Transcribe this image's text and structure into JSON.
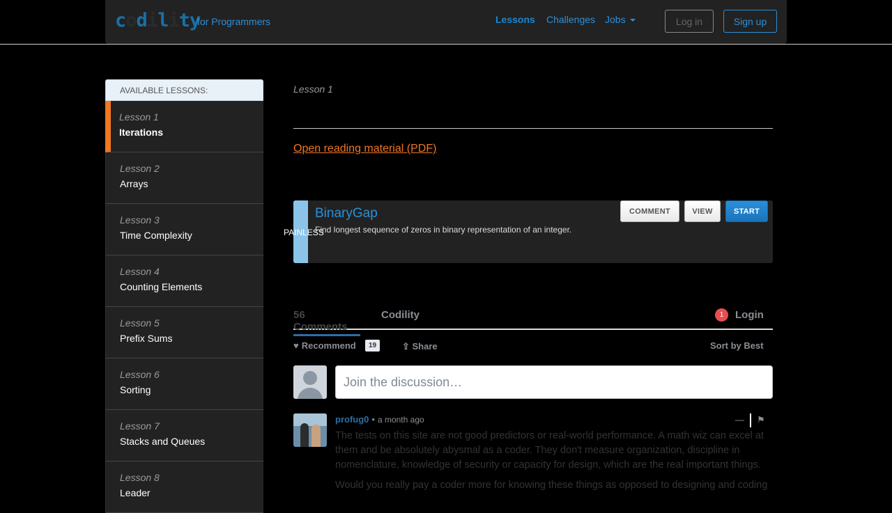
{
  "header": {
    "logo_text": [
      "c",
      "o",
      "d",
      "i",
      "l",
      "i",
      "t",
      "y"
    ],
    "tagline": "for Programmers",
    "nav": [
      {
        "label": "Lessons",
        "active": true
      },
      {
        "label": "Challenges",
        "active": false
      },
      {
        "label": "Jobs",
        "active": false
      }
    ],
    "login_label": "Log in",
    "signup_label": "Sign up"
  },
  "sidebar": {
    "heading": "AVAILABLE LESSONS:",
    "items": [
      {
        "num": "Lesson 1",
        "name": "Iterations"
      },
      {
        "num": "Lesson 2",
        "name": "Arrays"
      },
      {
        "num": "Lesson 3",
        "name": "Time Complexity"
      },
      {
        "num": "Lesson 4",
        "name": "Counting Elements"
      },
      {
        "num": "Lesson 5",
        "name": "Prefix Sums"
      },
      {
        "num": "Lesson 6",
        "name": "Sorting"
      },
      {
        "num": "Lesson 7",
        "name": "Stacks and Queues"
      },
      {
        "num": "Lesson 8",
        "name": "Leader"
      }
    ]
  },
  "main": {
    "lesson_label": "Lesson 1",
    "pdf_link": "Open reading material (PDF)",
    "task": {
      "difficulty": "PAINLESS",
      "title": "BinaryGap",
      "description": "Find longest sequence of zeros in binary representation of an integer.",
      "comment_label": "COMMENT",
      "view_label": "VIEW",
      "start_label": "START"
    }
  },
  "disqus": {
    "comments_tab": "56 Comments",
    "site_tab": "Codility",
    "notification_count": "1",
    "login_label": "Login",
    "recommend_label": "Recommend",
    "recommend_count": "19",
    "share_label": "Share",
    "sort_label": "Sort by Best",
    "input_placeholder": "Join the discussion…",
    "comment": {
      "author": "profug0",
      "time": "a month ago",
      "paragraphs": [
        "The tests on this site are not good predictors or real-world performance. A math wiz can excel at them and be absolutely abysmal as a coder. They don't measure organization, discipline in nomenclature, knowledge of security or capacity for design, which are the real important things.",
        "Would you really pay a coder more for knowing these things as opposed to designing and coding"
      ]
    }
  }
}
